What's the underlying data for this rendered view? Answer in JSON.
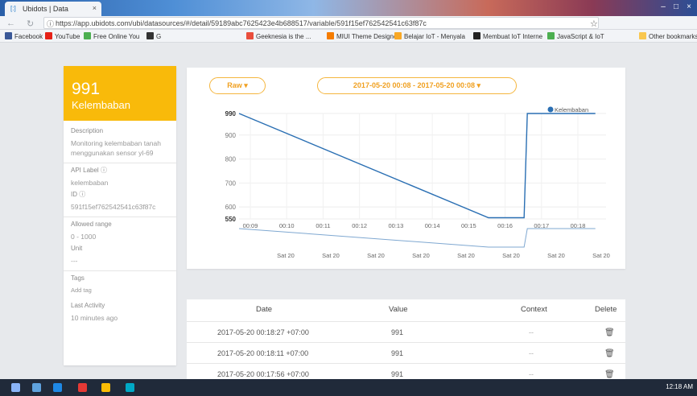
{
  "browser": {
    "tab_title": "Ubidots | Data",
    "tab_close": "×",
    "url": "https://app.ubidots.com/ubi/datasources/#/detail/59189abc7625423e4b688517/variable/591f15ef762542541c63f87c",
    "bookmarks": [
      "Facebook",
      "YouTube",
      "Free Online You",
      "G",
      "Geeknesia is the ...",
      "MIUI Theme Designe",
      "Belajar IoT - Menyala",
      "Membuat IoT Interne",
      "JavaScript & IoT",
      "Other bookmarks"
    ]
  },
  "sidebar": {
    "value": "991",
    "name": "Kelembaban",
    "description_label": "Description",
    "description": "Monitoring kelembaban tanah menggunakan sensor yl-69",
    "api_label_label": "API Label",
    "api_label": "kelembaban",
    "id_label": "ID",
    "id": "591f15ef762542541c63f87c",
    "range_label": "Allowed range",
    "range": "0 - 1000",
    "unit_label": "Unit",
    "unit": "---",
    "tags_label": "Tags",
    "tags_placeholder": "Add tag",
    "activity_label": "Last Activity",
    "activity": "10 minutes ago"
  },
  "controls": {
    "mode": "Raw ▾",
    "date_range": "2017-05-20 00:08 - 2017-05-20 00:08 ▾"
  },
  "chart_data": {
    "type": "line",
    "series": [
      {
        "name": "Kelembaban",
        "x": [
          "00:08",
          "00:15",
          "00:16",
          "00:16",
          "00:18"
        ],
        "values": [
          990,
          555,
          555,
          990,
          990
        ]
      }
    ],
    "y_ticks": [
      "990",
      "900",
      "800",
      "700",
      "600",
      "550"
    ],
    "ylim": [
      550,
      990
    ],
    "x_ticks": [
      "00:09",
      "00:10",
      "00:11",
      "00:12",
      "00:13",
      "00:14",
      "00:15",
      "00:16",
      "00:17",
      "00:18"
    ],
    "nav_ticks": [
      "Sat 20",
      "Sat 20",
      "Sat 20",
      "Sat 20",
      "Sat 20",
      "Sat 20",
      "Sat 20",
      "Sat 20"
    ],
    "color": "#2a6fb3",
    "legend": "top-right",
    "grid": true
  },
  "table": {
    "headers": [
      "Date",
      "Value",
      "Context",
      "Delete"
    ],
    "rows": [
      {
        "date": "2017-05-20 00:18:27 +07:00",
        "value": "991",
        "context": "--"
      },
      {
        "date": "2017-05-20 00:18:11 +07:00",
        "value": "991",
        "context": "--"
      },
      {
        "date": "2017-05-20 00:17:56 +07:00",
        "value": "991",
        "context": "--"
      }
    ]
  },
  "taskbar": {
    "time": "12:18 AM"
  }
}
